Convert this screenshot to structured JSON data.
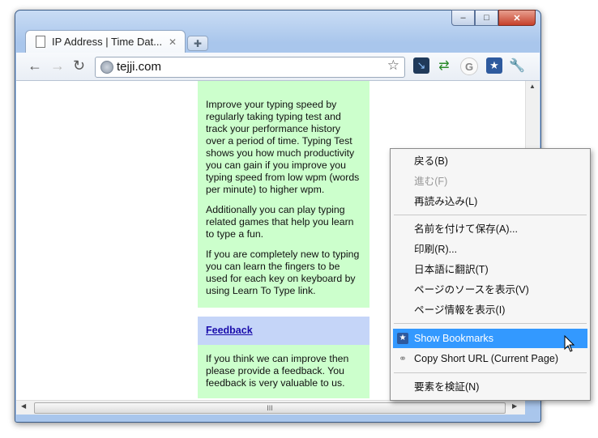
{
  "tab": {
    "title": "IP Address | Time Dat..."
  },
  "toolbar": {
    "url": "tejji.com"
  },
  "page": {
    "paragraphs": [
      "Improve your typing speed by regularly taking typing test and track your performance history over a period of time. Typing Test shows you how much productivity you can gain if you improve you typing speed from low wpm (words per minute) to higher wpm.",
      "Additionally you can play typing related games that help you learn to type a fun.",
      "If you are completely new to typing you can learn the fingers to be used for each key on keyboard by using Learn To Type link."
    ],
    "feedback_title": "Feedback",
    "feedback_text": "If you think we can improve then please provide a feedback. You feedback is very valuable to us."
  },
  "context_menu": {
    "items": [
      {
        "label": "戻る(B)",
        "enabled": true
      },
      {
        "label": "進む(F)",
        "enabled": false
      },
      {
        "label": "再読み込み(L)",
        "enabled": true
      },
      {
        "label": "名前を付けて保存(A)...",
        "enabled": true
      },
      {
        "label": "印刷(R)...",
        "enabled": true
      },
      {
        "label": "日本語に翻訳(T)",
        "enabled": true
      },
      {
        "label": "ページのソースを表示(V)",
        "enabled": true
      },
      {
        "label": "ページ情報を表示(I)",
        "enabled": true
      },
      {
        "label": "Show Bookmarks",
        "enabled": true,
        "highlighted": true,
        "icon": "bookmark-star-icon"
      },
      {
        "label": "Copy Short URL (Current Page)",
        "enabled": true,
        "icon": "link-icon"
      },
      {
        "label": "要素を検証(N)",
        "enabled": true
      }
    ]
  },
  "colors": {
    "highlight": "#3399ff",
    "panel_green": "#ccffcc",
    "panel_blue": "#c5d5f8"
  }
}
